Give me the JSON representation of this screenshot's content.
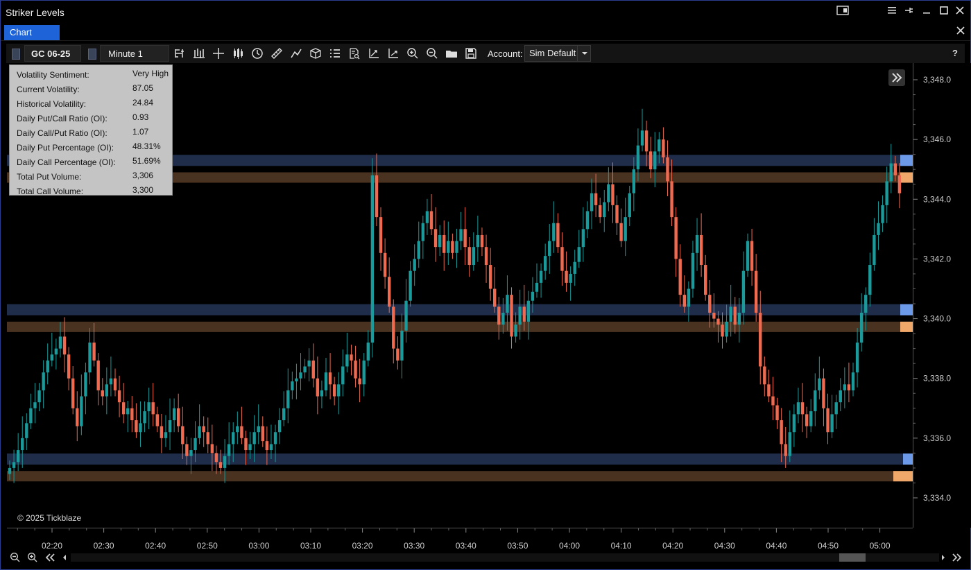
{
  "window": {
    "title": "Striker Levels"
  },
  "tabs": [
    {
      "label": "Chart"
    }
  ],
  "toolbar": {
    "instrument": "GC 06-25",
    "timeframe": "Minute 1",
    "account_label": "Account:",
    "account_value": "Sim Default",
    "help_label": "?",
    "icons": [
      "data-box-icon",
      "bar-type-icon",
      "crosshair-icon",
      "candlestick-icon",
      "clock-icon",
      "ruler-icon",
      "trend-line-icon",
      "object-icon",
      "list-icon",
      "inspect-icon",
      "axis-icon",
      "axis-alt-icon",
      "zoom-in-icon",
      "zoom-out-icon",
      "folder-icon",
      "save-icon"
    ]
  },
  "info_panel": {
    "rows": [
      {
        "key": "Volatility Sentiment:",
        "value": "Very High"
      },
      {
        "key": "Current Volatility:",
        "value": "87.05"
      },
      {
        "key": "Historical Volatility:",
        "value": "24.84"
      },
      {
        "key": "Daily Put/Call Ratio (OI):",
        "value": "0.93"
      },
      {
        "key": "Daily Call/Put Ratio (OI):",
        "value": "1.07"
      },
      {
        "key": "Daily Put Percentage (OI):",
        "value": "48.31%"
      },
      {
        "key": "Daily Call Percentage (OI):",
        "value": "51.69%"
      },
      {
        "key": "Total Put Volume:",
        "value": "3,306"
      },
      {
        "key": "Total Call Volume:",
        "value": "3,300"
      }
    ]
  },
  "copyright": "© 2025 Tickblaze",
  "colors": {
    "bull": "#1a9a9a",
    "bear": "#ee6a50",
    "level_call": "#1f2d4a",
    "level_put": "#4a3220",
    "marker_call": "#6d9ae8",
    "marker_put": "#f0a86a"
  },
  "chart_data": {
    "type": "candlestick",
    "y_ticks": [
      "3,348.0",
      "3,346.0",
      "3,344.0",
      "3,342.0",
      "3,340.0",
      "3,338.0",
      "3,336.0",
      "3,334.0"
    ],
    "y_tick_values": [
      3348,
      3346,
      3344,
      3342,
      3340,
      3338,
      3336,
      3334
    ],
    "x_ticks": [
      "02:20",
      "02:30",
      "02:40",
      "02:50",
      "03:00",
      "03:10",
      "03:20",
      "03:30",
      "03:40",
      "03:50",
      "04:00",
      "04:10",
      "04:20",
      "04:30",
      "04:40",
      "04:50",
      "05:00"
    ],
    "levels": [
      {
        "call": 3345.3,
        "put": 3344.9
      },
      {
        "call": 3340.3,
        "put": 3339.9
      },
      {
        "call": 3335.3,
        "put": 3334.9
      }
    ],
    "closes": [
      3335,
      3335.2,
      3335.6,
      3336,
      3336.5,
      3337,
      3337.2,
      3337.6,
      3338.2,
      3338.6,
      3338.8,
      3339,
      3339.4,
      3338.8,
      3338,
      3337,
      3336.4,
      3337.4,
      3338.2,
      3339.2,
      3338.6,
      3337.6,
      3337.4,
      3337.8,
      3338,
      3337.6,
      3337.2,
      3336.8,
      3337,
      3336.6,
      3336.2,
      3336.5,
      3336.9,
      3337.2,
      3336.8,
      3336.4,
      3336,
      3336.2,
      3336.6,
      3337,
      3336.4,
      3335.8,
      3335.4,
      3335.6,
      3336,
      3336.4,
      3336.2,
      3335.8,
      3335.5,
      3335.2,
      3335,
      3335.4,
      3335.8,
      3336.2,
      3336.4,
      3336,
      3335.6,
      3335.8,
      3336.2,
      3336.4,
      3335.9,
      3335.6,
      3335.8,
      3336.2,
      3336.6,
      3337,
      3337.6,
      3337.9,
      3338,
      3338.2,
      3338.4,
      3338.6,
      3338,
      3337.4,
      3337.6,
      3338.2,
      3337.8,
      3337.4,
      3337.8,
      3338.4,
      3338.8,
      3338.6,
      3338,
      3337.8,
      3338.6,
      3339.2,
      3344.8,
      3343.4,
      3342.2,
      3341.4,
      3340.4,
      3339,
      3338.6,
      3339.6,
      3340.6,
      3341.6,
      3342,
      3342.6,
      3343.2,
      3343.6,
      3343,
      3342.4,
      3342.8,
      3342.2,
      3342.6,
      3342.2,
      3342.6,
      3343,
      3342.4,
      3341.8,
      3342.4,
      3342.8,
      3342.4,
      3341.8,
      3341,
      3340.4,
      3339.8,
      3340.2,
      3340.8,
      3339.4,
      3339.8,
      3340.4,
      3339.9,
      3340.6,
      3340.9,
      3341.2,
      3341.6,
      3342.1,
      3342.6,
      3343.2,
      3342.4,
      3341.6,
      3341.2,
      3341.5,
      3341.9,
      3342.4,
      3343,
      3343.6,
      3344.2,
      3343.8,
      3343.4,
      3343.9,
      3344.5,
      3343.8,
      3343.2,
      3342.6,
      3343.4,
      3344.2,
      3345,
      3345.8,
      3346.3,
      3345.6,
      3345,
      3345.6,
      3346,
      3345.4,
      3344.6,
      3343.4,
      3342,
      3340.8,
      3340.4,
      3341,
      3342.2,
      3342.8,
      3341.8,
      3340.8,
      3340.2,
      3340,
      3339.8,
      3339.4,
      3339.9,
      3340.4,
      3339.8,
      3340.2,
      3341.6,
      3342.6,
      3341.6,
      3340.2,
      3338.4,
      3337.8,
      3337.4,
      3337.1,
      3336.6,
      3335.8,
      3335.4,
      3336.2,
      3336.8,
      3337.2,
      3336.8,
      3336.4,
      3336.9,
      3337.6,
      3338,
      3337,
      3336.2,
      3336.8,
      3337.2,
      3337.6,
      3337.8,
      3337.6,
      3338.2,
      3339.2,
      3340.2,
      3340.8,
      3341.8,
      3342.8,
      3343.2,
      3343.8,
      3344.6,
      3345.2,
      3344.8,
      3344.2
    ]
  }
}
